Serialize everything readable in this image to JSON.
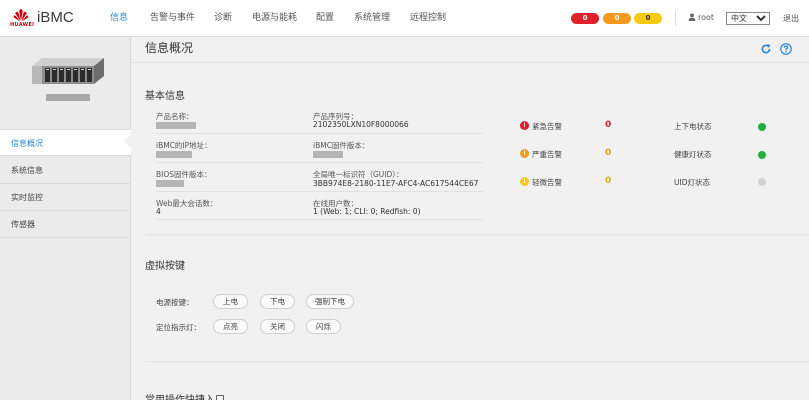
{
  "brand": {
    "vendor": "HUAWEI",
    "product": "iBMC",
    "color": "#c7000b"
  },
  "nav": {
    "items": [
      "信息",
      "告警与事件",
      "诊断",
      "电源与能耗",
      "配置",
      "系统管理",
      "远程控制"
    ],
    "active_index": 0
  },
  "alarms_bar": {
    "critical": "0",
    "major": "0",
    "minor": "0"
  },
  "user": {
    "icon": "user-icon",
    "name": "root"
  },
  "language": {
    "selected": "中文"
  },
  "logout_label": "退出",
  "sidebar": {
    "items": [
      "信息概况",
      "系统信息",
      "实时监控",
      "传感器"
    ],
    "active_index": 0
  },
  "page": {
    "title": "信息概况"
  },
  "basic_info": {
    "title": "基本信息",
    "fields": {
      "product_name": {
        "label": "产品名称："
      },
      "serial": {
        "label": "产品序列号：",
        "value": "2102350LXN10F8000066"
      },
      "ip": {
        "label": "iBMC的IP地址："
      },
      "firmware": {
        "label": "iBMC固件版本："
      },
      "bios": {
        "label": "BIOS固件版本："
      },
      "guid": {
        "label": "全局唯一标识符（GUID）：",
        "value": "3BB974E8-2180-11E7-AFC4-AC617544CE67"
      },
      "sessions_max": {
        "label": "Web最大会话数：",
        "value": "4"
      },
      "online_users": {
        "label": "在线用户数：",
        "value": "1 (Web: 1; CLI: 0; Redfish: 0)"
      }
    },
    "alarms": [
      {
        "label": "紧急告警",
        "count": "0",
        "color": "#e0202a",
        "icon": "critical-alarm-icon"
      },
      {
        "label": "严重告警",
        "count": "0",
        "color": "#f39a1e",
        "icon": "major-alarm-icon"
      },
      {
        "label": "轻微告警",
        "count": "0",
        "color": "#f7c912",
        "icon": "minor-alarm-icon"
      }
    ],
    "status": [
      {
        "label": "上下电状态",
        "color": "#1fb040"
      },
      {
        "label": "健康灯状态",
        "color": "#1fb040"
      },
      {
        "label": "UID灯状态",
        "color": "#d2d2d2"
      }
    ]
  },
  "virtual_buttons": {
    "title": "虚拟按键",
    "power": {
      "label": "电源按键：",
      "buttons": [
        "上电",
        "下电",
        "强制下电"
      ]
    },
    "locator": {
      "label": "定位指示灯：",
      "buttons": [
        "点亮",
        "关闭",
        "闪烁"
      ]
    }
  },
  "quick_entry": {
    "title": "常用操作快捷入口"
  }
}
